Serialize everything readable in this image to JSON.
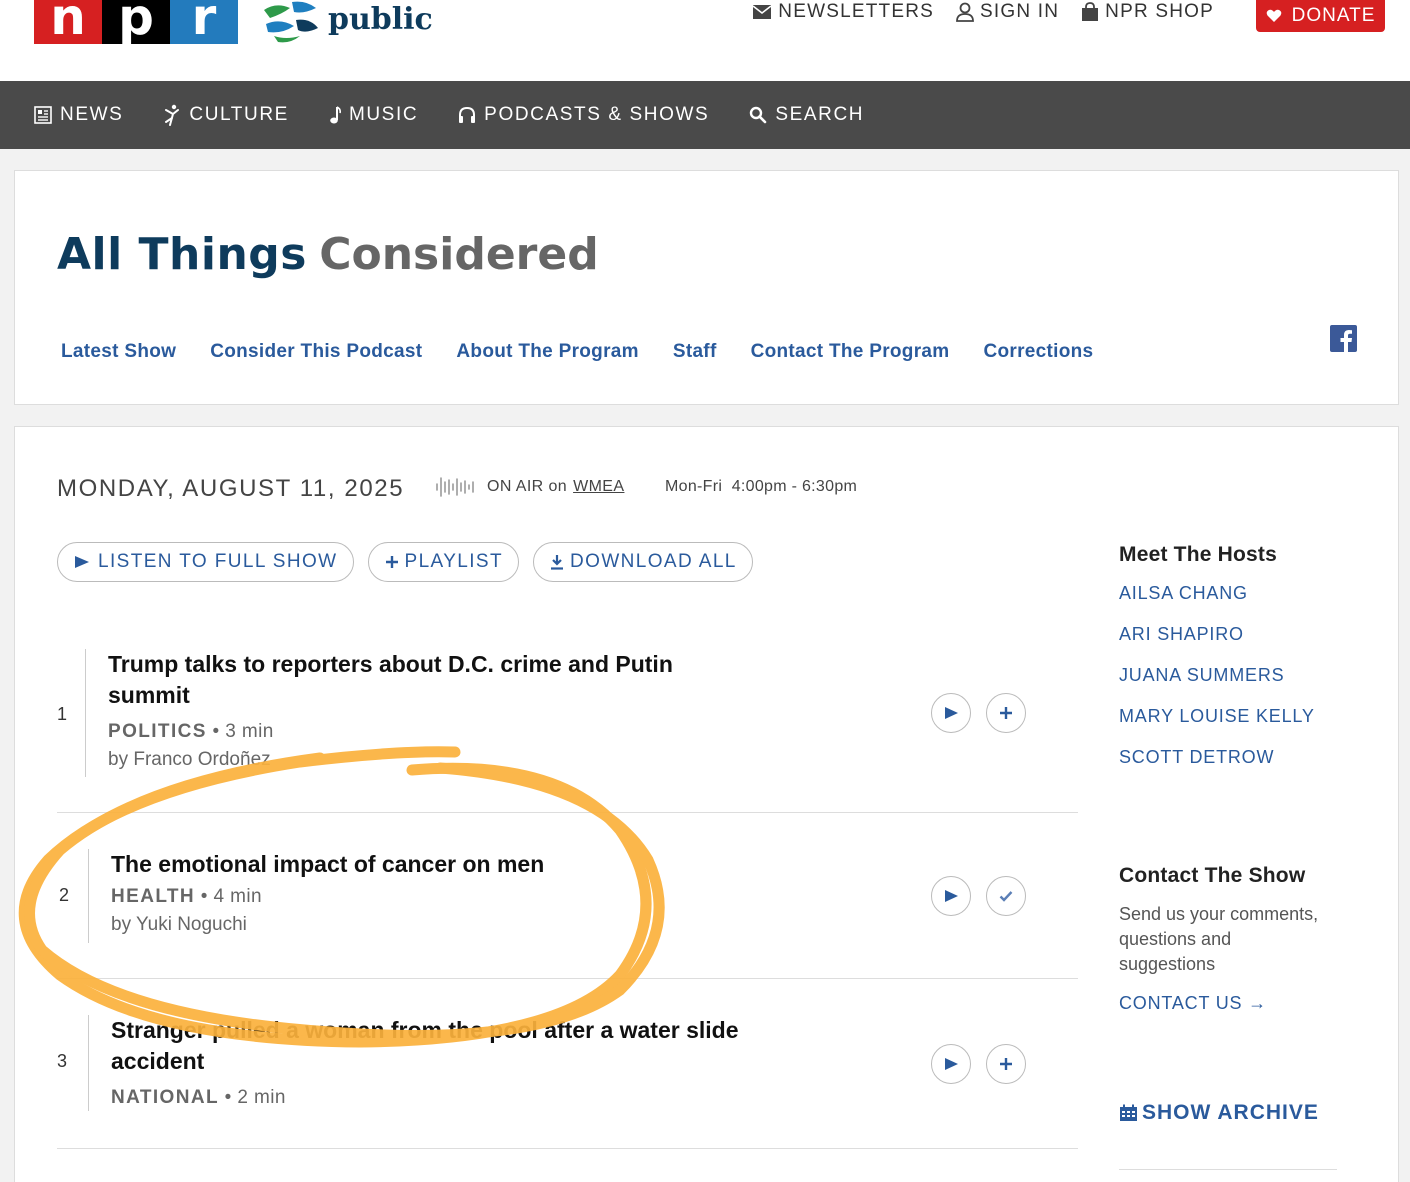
{
  "brand": {
    "npr_letters": [
      "n",
      "p",
      "r"
    ],
    "station_logo_text": "public",
    "colors": {
      "npr_red": "#d62021",
      "npr_black": "#000000",
      "npr_blue": "#237bbd",
      "link_blue": "#2a5a9c",
      "title_navy": "#0e3b5c",
      "nav_bg": "#4a4a4a",
      "highlight": "#fbb13c"
    }
  },
  "utility_nav": {
    "newsletters": "NEWSLETTERS",
    "sign_in": "SIGN IN",
    "shop": "NPR SHOP",
    "donate": "DONATE"
  },
  "main_nav": {
    "items": [
      {
        "label": "NEWS",
        "icon": "newspaper-icon"
      },
      {
        "label": "CULTURE",
        "icon": "culture-icon"
      },
      {
        "label": "MUSIC",
        "icon": "music-note-icon"
      },
      {
        "label": "PODCASTS & SHOWS",
        "icon": "headphones-icon"
      },
      {
        "label": "SEARCH",
        "icon": "search-icon"
      }
    ]
  },
  "show": {
    "title_strong": "All Things",
    "title_light": "Considered",
    "subnav": [
      "Latest Show",
      "Consider This Podcast",
      "About The Program",
      "Staff",
      "Contact The Program",
      "Corrections"
    ]
  },
  "episode": {
    "date": "MONDAY, AUGUST 11, 2025",
    "on_air_prefix": "ON AIR on",
    "station": "WMEA",
    "schedule": "Mon-Fri  4:00pm - 6:30pm",
    "buttons": {
      "listen": "LISTEN TO FULL SHOW",
      "playlist": "PLAYLIST",
      "download": "DOWNLOAD ALL"
    }
  },
  "stories": [
    {
      "num": "1",
      "title": "Trump talks to reporters about D.C. crime and Putin summit",
      "tag": "POLITICS",
      "duration": "3 min",
      "byline": "by Franco Ordoñez",
      "added": false
    },
    {
      "num": "2",
      "title": "The emotional impact of cancer on men",
      "tag": "HEALTH",
      "duration": "4 min",
      "byline": "by Yuki Noguchi",
      "added": true
    },
    {
      "num": "3",
      "title": "Stranger pulled a woman from the pool after a water slide accident",
      "tag": "NATIONAL",
      "duration": "2 min",
      "byline": "",
      "added": false
    }
  ],
  "sidebar": {
    "hosts_heading": "Meet The Hosts",
    "hosts": [
      "AILSA CHANG",
      "ARI SHAPIRO",
      "JUANA SUMMERS",
      "MARY LOUISE KELLY",
      "SCOTT DETROW"
    ],
    "contact_heading": "Contact The Show",
    "contact_text": "Send us your comments, questions and suggestions",
    "contact_link": "CONTACT US →",
    "archive": "SHOW ARCHIVE"
  }
}
